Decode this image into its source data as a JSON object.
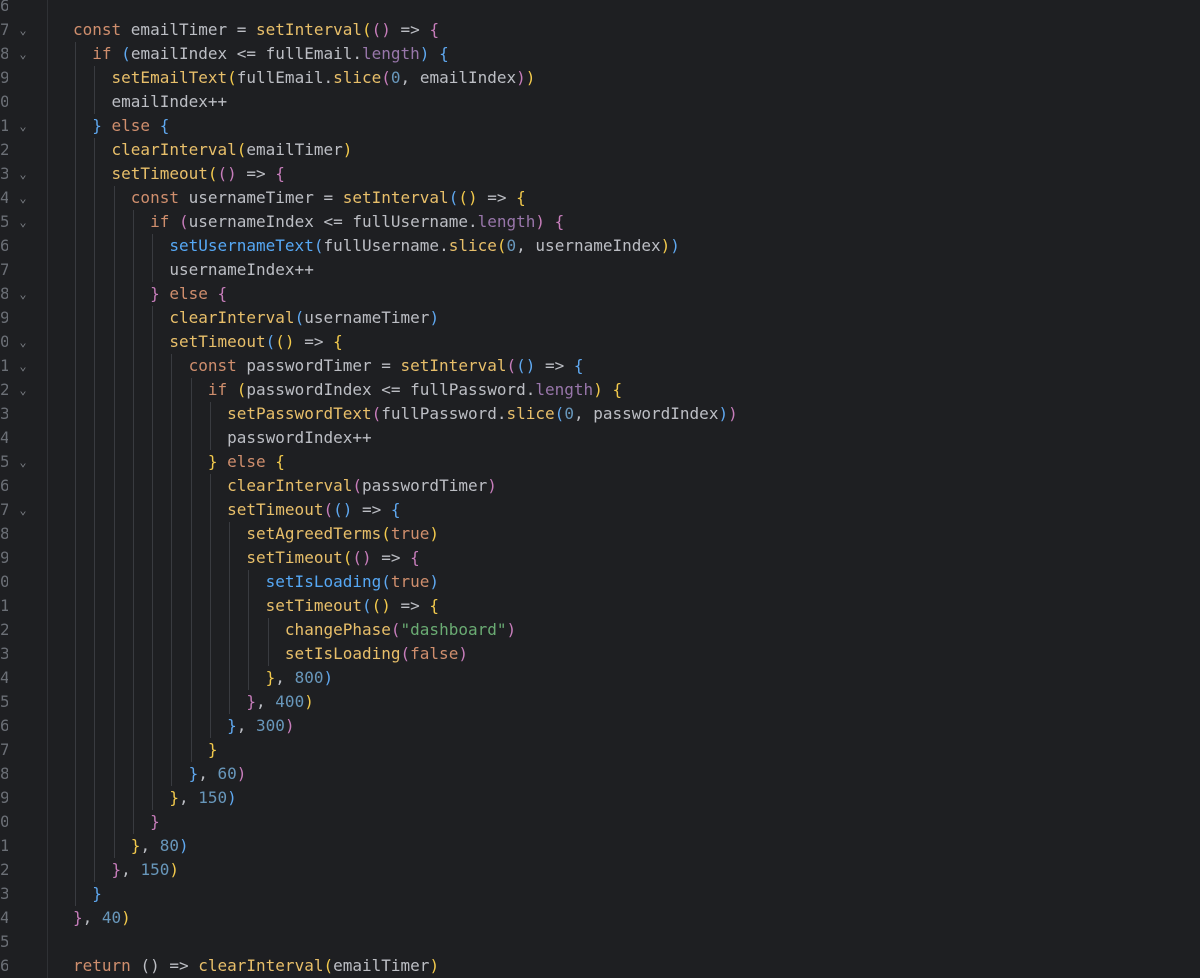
{
  "editor": {
    "theme_colors": {
      "background": "#1e1f22",
      "keyword": "#cf8e6d",
      "function": "#e8bf6a",
      "property": "#9876aa",
      "number": "#6897bb",
      "string": "#6aab73",
      "bracket_level_1": "#f2c94c",
      "bracket_level_2": "#c77dbb",
      "bracket_level_3": "#5fa8f0"
    },
    "lines": [
      {
        "num": "6",
        "fold": "",
        "tokens": [
          {
            "t": "",
            "c": "tx"
          }
        ]
      },
      {
        "num": "7",
        "fold": "chevron-down",
        "tokens": [
          {
            "t": "const ",
            "c": "kw"
          },
          {
            "t": "emailTimer = ",
            "c": "tx"
          },
          {
            "t": "setInterval",
            "c": "fn"
          },
          {
            "t": "(",
            "c": "p1"
          },
          {
            "t": "()",
            "c": "p2"
          },
          {
            "t": " => ",
            "c": "tx"
          },
          {
            "t": "{",
            "c": "p2"
          }
        ]
      },
      {
        "num": "8",
        "fold": "chevron-down",
        "tokens": [
          {
            "t": "  ",
            "c": "tx"
          },
          {
            "t": "if ",
            "c": "kw"
          },
          {
            "t": "(",
            "c": "p3"
          },
          {
            "t": "emailIndex <= fullEmail.",
            "c": "tx"
          },
          {
            "t": "length",
            "c": "pr"
          },
          {
            "t": ") {",
            "c": "p3"
          }
        ]
      },
      {
        "num": "9",
        "fold": "",
        "tokens": [
          {
            "t": "    ",
            "c": "tx"
          },
          {
            "t": "setEmailText",
            "c": "fn"
          },
          {
            "t": "(",
            "c": "p1"
          },
          {
            "t": "fullEmail.",
            "c": "tx"
          },
          {
            "t": "slice",
            "c": "fn"
          },
          {
            "t": "(",
            "c": "p2"
          },
          {
            "t": "0",
            "c": "num"
          },
          {
            "t": ", emailIndex",
            "c": "tx"
          },
          {
            "t": ")",
            "c": "p2"
          },
          {
            "t": ")",
            "c": "p1"
          }
        ]
      },
      {
        "num": "0",
        "fold": "",
        "tokens": [
          {
            "t": "    emailIndex++",
            "c": "tx"
          }
        ]
      },
      {
        "num": "1",
        "fold": "chevron-down",
        "tokens": [
          {
            "t": "  ",
            "c": "tx"
          },
          {
            "t": "} ",
            "c": "p3"
          },
          {
            "t": "else ",
            "c": "kw"
          },
          {
            "t": "{",
            "c": "p3"
          }
        ]
      },
      {
        "num": "2",
        "fold": "",
        "tokens": [
          {
            "t": "    ",
            "c": "tx"
          },
          {
            "t": "clearInterval",
            "c": "fn"
          },
          {
            "t": "(",
            "c": "p1"
          },
          {
            "t": "emailTimer",
            "c": "tx"
          },
          {
            "t": ")",
            "c": "p1"
          }
        ]
      },
      {
        "num": "3",
        "fold": "chevron-down",
        "tokens": [
          {
            "t": "    ",
            "c": "tx"
          },
          {
            "t": "setTimeout",
            "c": "fn"
          },
          {
            "t": "(",
            "c": "p1"
          },
          {
            "t": "()",
            "c": "p2"
          },
          {
            "t": " => ",
            "c": "tx"
          },
          {
            "t": "{",
            "c": "p2"
          }
        ]
      },
      {
        "num": "4",
        "fold": "chevron-down",
        "tokens": [
          {
            "t": "      ",
            "c": "tx"
          },
          {
            "t": "const ",
            "c": "kw"
          },
          {
            "t": "usernameTimer = ",
            "c": "tx"
          },
          {
            "t": "setInterval",
            "c": "fn"
          },
          {
            "t": "(",
            "c": "p3"
          },
          {
            "t": "()",
            "c": "p1"
          },
          {
            "t": " => ",
            "c": "tx"
          },
          {
            "t": "{",
            "c": "p1"
          }
        ]
      },
      {
        "num": "5",
        "fold": "chevron-down",
        "tokens": [
          {
            "t": "        ",
            "c": "tx"
          },
          {
            "t": "if ",
            "c": "kw"
          },
          {
            "t": "(",
            "c": "p2"
          },
          {
            "t": "usernameIndex <= fullUsername.",
            "c": "tx"
          },
          {
            "t": "length",
            "c": "pr"
          },
          {
            "t": ") {",
            "c": "p2"
          }
        ]
      },
      {
        "num": "6",
        "fold": "",
        "tokens": [
          {
            "t": "          ",
            "c": "tx"
          },
          {
            "t": "setUsernameText",
            "c": "fnb"
          },
          {
            "t": "(",
            "c": "p3"
          },
          {
            "t": "fullUsername.",
            "c": "tx"
          },
          {
            "t": "slice",
            "c": "fn"
          },
          {
            "t": "(",
            "c": "p1"
          },
          {
            "t": "0",
            "c": "num"
          },
          {
            "t": ", usernameIndex",
            "c": "tx"
          },
          {
            "t": ")",
            "c": "p1"
          },
          {
            "t": ")",
            "c": "p3"
          }
        ]
      },
      {
        "num": "7",
        "fold": "",
        "tokens": [
          {
            "t": "          usernameIndex++",
            "c": "tx"
          }
        ]
      },
      {
        "num": "8",
        "fold": "chevron-down",
        "tokens": [
          {
            "t": "        ",
            "c": "tx"
          },
          {
            "t": "} ",
            "c": "p2"
          },
          {
            "t": "else ",
            "c": "kw"
          },
          {
            "t": "{",
            "c": "p2"
          }
        ]
      },
      {
        "num": "9",
        "fold": "",
        "tokens": [
          {
            "t": "          ",
            "c": "tx"
          },
          {
            "t": "clearInterval",
            "c": "fn"
          },
          {
            "t": "(",
            "c": "p3"
          },
          {
            "t": "usernameTimer",
            "c": "tx"
          },
          {
            "t": ")",
            "c": "p3"
          }
        ]
      },
      {
        "num": "0",
        "fold": "chevron-down",
        "tokens": [
          {
            "t": "          ",
            "c": "tx"
          },
          {
            "t": "setTimeout",
            "c": "fn"
          },
          {
            "t": "(",
            "c": "p3"
          },
          {
            "t": "()",
            "c": "p1"
          },
          {
            "t": " => ",
            "c": "tx"
          },
          {
            "t": "{",
            "c": "p1"
          }
        ]
      },
      {
        "num": "1",
        "fold": "chevron-down",
        "tokens": [
          {
            "t": "            ",
            "c": "tx"
          },
          {
            "t": "const ",
            "c": "kw"
          },
          {
            "t": "passwordTimer = ",
            "c": "tx"
          },
          {
            "t": "setInterval",
            "c": "fn"
          },
          {
            "t": "(",
            "c": "p2"
          },
          {
            "t": "()",
            "c": "p3"
          },
          {
            "t": " => ",
            "c": "tx"
          },
          {
            "t": "{",
            "c": "p3"
          }
        ]
      },
      {
        "num": "2",
        "fold": "chevron-down",
        "tokens": [
          {
            "t": "              ",
            "c": "tx"
          },
          {
            "t": "if ",
            "c": "kw"
          },
          {
            "t": "(",
            "c": "p1"
          },
          {
            "t": "passwordIndex <= fullPassword.",
            "c": "tx"
          },
          {
            "t": "length",
            "c": "pr"
          },
          {
            "t": ") {",
            "c": "p1"
          }
        ]
      },
      {
        "num": "3",
        "fold": "",
        "tokens": [
          {
            "t": "                ",
            "c": "tx"
          },
          {
            "t": "setPasswordText",
            "c": "fn"
          },
          {
            "t": "(",
            "c": "p2"
          },
          {
            "t": "fullPassword.",
            "c": "tx"
          },
          {
            "t": "slice",
            "c": "fn"
          },
          {
            "t": "(",
            "c": "p3"
          },
          {
            "t": "0",
            "c": "num"
          },
          {
            "t": ", passwordIndex",
            "c": "tx"
          },
          {
            "t": ")",
            "c": "p3"
          },
          {
            "t": ")",
            "c": "p2"
          }
        ]
      },
      {
        "num": "4",
        "fold": "",
        "tokens": [
          {
            "t": "                passwordIndex++",
            "c": "tx"
          }
        ]
      },
      {
        "num": "5",
        "fold": "chevron-down",
        "tokens": [
          {
            "t": "              ",
            "c": "tx"
          },
          {
            "t": "} ",
            "c": "p1"
          },
          {
            "t": "else ",
            "c": "kw"
          },
          {
            "t": "{",
            "c": "p1"
          }
        ]
      },
      {
        "num": "6",
        "fold": "",
        "tokens": [
          {
            "t": "                ",
            "c": "tx"
          },
          {
            "t": "clearInterval",
            "c": "fn"
          },
          {
            "t": "(",
            "c": "p2"
          },
          {
            "t": "passwordTimer",
            "c": "tx"
          },
          {
            "t": ")",
            "c": "p2"
          }
        ]
      },
      {
        "num": "7",
        "fold": "chevron-down",
        "tokens": [
          {
            "t": "                ",
            "c": "tx"
          },
          {
            "t": "setTimeout",
            "c": "fn"
          },
          {
            "t": "(",
            "c": "p2"
          },
          {
            "t": "()",
            "c": "p3"
          },
          {
            "t": " => ",
            "c": "tx"
          },
          {
            "t": "{",
            "c": "p3"
          }
        ]
      },
      {
        "num": "8",
        "fold": "",
        "tokens": [
          {
            "t": "                  ",
            "c": "tx"
          },
          {
            "t": "setAgreedTerms",
            "c": "fn"
          },
          {
            "t": "(",
            "c": "p1"
          },
          {
            "t": "true",
            "c": "kw"
          },
          {
            "t": ")",
            "c": "p1"
          }
        ]
      },
      {
        "num": "9",
        "fold": "",
        "tokens": [
          {
            "t": "                  ",
            "c": "tx"
          },
          {
            "t": "setTimeout",
            "c": "fn"
          },
          {
            "t": "(",
            "c": "p1"
          },
          {
            "t": "()",
            "c": "p2"
          },
          {
            "t": " => ",
            "c": "tx"
          },
          {
            "t": "{",
            "c": "p2"
          }
        ]
      },
      {
        "num": "0",
        "fold": "",
        "tokens": [
          {
            "t": "                    ",
            "c": "tx"
          },
          {
            "t": "setIsLoading",
            "c": "fnb"
          },
          {
            "t": "(",
            "c": "p3"
          },
          {
            "t": "true",
            "c": "kw"
          },
          {
            "t": ")",
            "c": "p3"
          }
        ]
      },
      {
        "num": "1",
        "fold": "",
        "tokens": [
          {
            "t": "                    ",
            "c": "tx"
          },
          {
            "t": "setTimeout",
            "c": "fn"
          },
          {
            "t": "(",
            "c": "p3"
          },
          {
            "t": "()",
            "c": "p1"
          },
          {
            "t": " => ",
            "c": "tx"
          },
          {
            "t": "{",
            "c": "p1"
          }
        ]
      },
      {
        "num": "2",
        "fold": "",
        "tokens": [
          {
            "t": "                      ",
            "c": "tx"
          },
          {
            "t": "changePhase",
            "c": "fn"
          },
          {
            "t": "(",
            "c": "p2"
          },
          {
            "t": "\"dashboard\"",
            "c": "str"
          },
          {
            "t": ")",
            "c": "p2"
          }
        ]
      },
      {
        "num": "3",
        "fold": "",
        "tokens": [
          {
            "t": "                      ",
            "c": "tx"
          },
          {
            "t": "setIsLoading",
            "c": "fn"
          },
          {
            "t": "(",
            "c": "p2"
          },
          {
            "t": "false",
            "c": "kw"
          },
          {
            "t": ")",
            "c": "p2"
          }
        ]
      },
      {
        "num": "4",
        "fold": "",
        "tokens": [
          {
            "t": "                    ",
            "c": "tx"
          },
          {
            "t": "}",
            "c": "p1"
          },
          {
            "t": ", ",
            "c": "tx"
          },
          {
            "t": "800",
            "c": "num"
          },
          {
            "t": ")",
            "c": "p3"
          }
        ]
      },
      {
        "num": "5",
        "fold": "",
        "tokens": [
          {
            "t": "                  ",
            "c": "tx"
          },
          {
            "t": "}",
            "c": "p2"
          },
          {
            "t": ", ",
            "c": "tx"
          },
          {
            "t": "400",
            "c": "num"
          },
          {
            "t": ")",
            "c": "p1"
          }
        ]
      },
      {
        "num": "6",
        "fold": "",
        "tokens": [
          {
            "t": "                ",
            "c": "tx"
          },
          {
            "t": "}",
            "c": "p3"
          },
          {
            "t": ", ",
            "c": "tx"
          },
          {
            "t": "300",
            "c": "num"
          },
          {
            "t": ")",
            "c": "p2"
          }
        ]
      },
      {
        "num": "7",
        "fold": "",
        "tokens": [
          {
            "t": "              ",
            "c": "tx"
          },
          {
            "t": "}",
            "c": "p1"
          }
        ]
      },
      {
        "num": "8",
        "fold": "",
        "tokens": [
          {
            "t": "            ",
            "c": "tx"
          },
          {
            "t": "}",
            "c": "p3"
          },
          {
            "t": ", ",
            "c": "tx"
          },
          {
            "t": "60",
            "c": "num"
          },
          {
            "t": ")",
            "c": "p2"
          }
        ]
      },
      {
        "num": "9",
        "fold": "",
        "tokens": [
          {
            "t": "          ",
            "c": "tx"
          },
          {
            "t": "}",
            "c": "p1"
          },
          {
            "t": ", ",
            "c": "tx"
          },
          {
            "t": "150",
            "c": "num"
          },
          {
            "t": ")",
            "c": "p3"
          }
        ]
      },
      {
        "num": "0",
        "fold": "",
        "tokens": [
          {
            "t": "        ",
            "c": "tx"
          },
          {
            "t": "}",
            "c": "p2"
          }
        ]
      },
      {
        "num": "1",
        "fold": "",
        "tokens": [
          {
            "t": "      ",
            "c": "tx"
          },
          {
            "t": "}",
            "c": "p1"
          },
          {
            "t": ", ",
            "c": "tx"
          },
          {
            "t": "80",
            "c": "num"
          },
          {
            "t": ")",
            "c": "p3"
          }
        ]
      },
      {
        "num": "2",
        "fold": "",
        "tokens": [
          {
            "t": "    ",
            "c": "tx"
          },
          {
            "t": "}",
            "c": "p2"
          },
          {
            "t": ", ",
            "c": "tx"
          },
          {
            "t": "150",
            "c": "num"
          },
          {
            "t": ")",
            "c": "p1"
          }
        ]
      },
      {
        "num": "3",
        "fold": "",
        "tokens": [
          {
            "t": "  ",
            "c": "tx"
          },
          {
            "t": "}",
            "c": "p3"
          }
        ]
      },
      {
        "num": "4",
        "fold": "",
        "tokens": [
          {
            "t": "}",
            "c": "p2"
          },
          {
            "t": ", ",
            "c": "tx"
          },
          {
            "t": "40",
            "c": "num"
          },
          {
            "t": ")",
            "c": "p1"
          }
        ]
      },
      {
        "num": "5",
        "fold": "",
        "tokens": [
          {
            "t": "",
            "c": "tx"
          }
        ]
      },
      {
        "num": "6",
        "fold": "",
        "tokens": [
          {
            "t": "return ",
            "c": "kw"
          },
          {
            "t": "() => ",
            "c": "tx"
          },
          {
            "t": "clearInterval",
            "c": "fn"
          },
          {
            "t": "(",
            "c": "p1"
          },
          {
            "t": "emailTimer",
            "c": "tx"
          },
          {
            "t": ")",
            "c": "p1"
          }
        ]
      }
    ]
  }
}
